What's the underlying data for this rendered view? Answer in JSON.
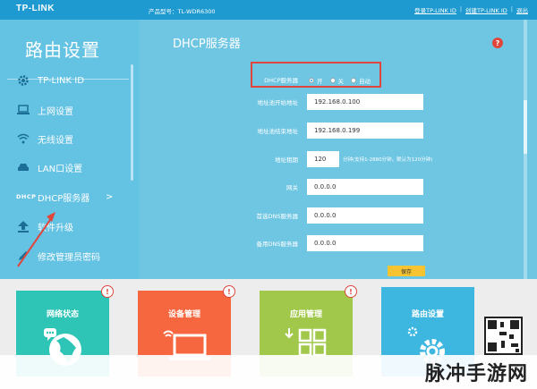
{
  "header": {
    "logo": "TP-LINK",
    "model": "产品型号：TL-WDR6300",
    "links": [
      "登录TP-LINK ID",
      "创建TP-LINK ID",
      "退出"
    ],
    "separator": "|"
  },
  "sidebar": {
    "title": "路由设置",
    "items": [
      {
        "icon": "gear-icon",
        "label": "TP-LINK ID"
      },
      {
        "icon": "laptop-icon",
        "label": "上网设置"
      },
      {
        "icon": "wifi-icon",
        "label": "无线设置"
      },
      {
        "icon": "car-icon",
        "label": "LAN口设置"
      },
      {
        "icon": "dhcp-icon",
        "icon_text": "DHCP",
        "label": "DHCP服务器",
        "chevron": ">"
      },
      {
        "icon": "upload-icon",
        "label": "软件升级"
      },
      {
        "icon": "pencil-icon",
        "label": "修改管理员密码"
      }
    ]
  },
  "main": {
    "title": "DHCP服务器",
    "help": "?",
    "dhcp_label": "DHCP服务器",
    "dhcp_options": [
      "开",
      "关",
      "自动"
    ],
    "dhcp_selected": "开",
    "fields": [
      {
        "label": "地址池开始地址",
        "value": "192.168.0.100"
      },
      {
        "label": "地址池结束地址",
        "value": "192.168.0.199"
      },
      {
        "label": "地址租期",
        "value": "120",
        "hint": "分钟(支持1-2880分钟，默认为120分钟)"
      },
      {
        "label": "网关",
        "value": "0.0.0.0"
      },
      {
        "label": "首选DNS服务器",
        "value": "0.0.0.0"
      },
      {
        "label": "备用DNS服务器",
        "value": "0.0.0.0"
      }
    ],
    "save": "保存"
  },
  "tiles": [
    {
      "label": "网络状态",
      "badge": "!",
      "icon": "globe-icon",
      "color": "#2ec5b7"
    },
    {
      "label": "设备管理",
      "badge": "!",
      "icon": "laptop-icon",
      "color": "#f7673f"
    },
    {
      "label": "应用管理",
      "badge": "!",
      "icon": "apps-icon",
      "color": "#a1c84a"
    },
    {
      "label": "路由设置",
      "badge": "",
      "icon": "gear-icon",
      "color": "#3db6e0"
    }
  ],
  "watermark": "脉冲手游网"
}
